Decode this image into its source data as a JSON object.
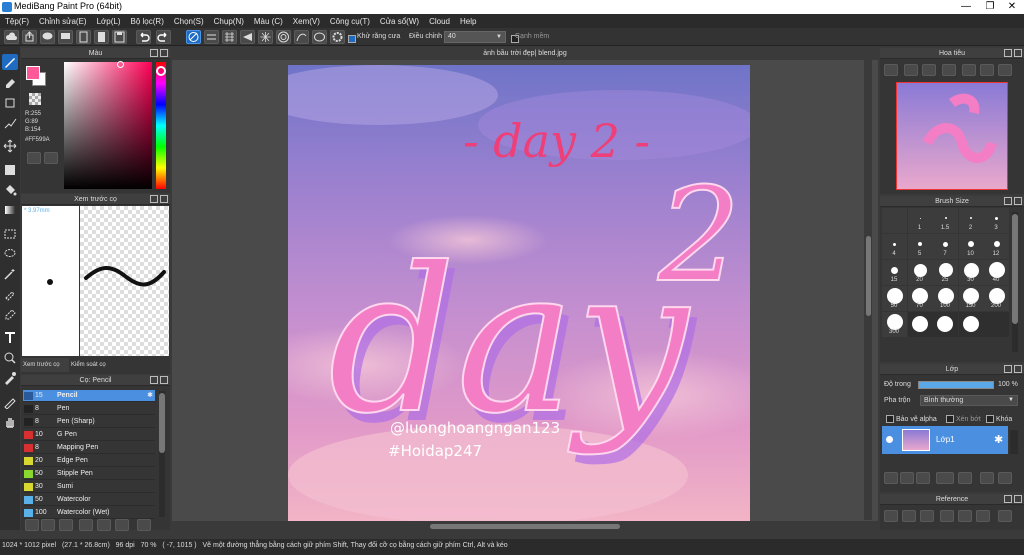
{
  "window": {
    "title": "MediBang Paint Pro (64bit)"
  },
  "menu": [
    "Tệp(F)",
    "Chỉnh sửa(E)",
    "Lớp(L)",
    "Bộ lọc(R)",
    "Chọn(S)",
    "Chụp(N)",
    "Màu (C)",
    "Xem(V)",
    "Công cụ(T)",
    "Cửa sổ(W)",
    "Cloud",
    "Help"
  ],
  "toolbar": {
    "antialias_label": "Khử răng cưa",
    "correction_label": "Điều chỉnh",
    "correction_value": "40",
    "smooth_label": "Cạnh mềm"
  },
  "color_panel": {
    "title": "Màu",
    "r": "R:255",
    "g": "G:89",
    "b": "B:154",
    "hex": "#FF599A",
    "fg_color": "#ff599a",
    "bg_color": "#ffffff"
  },
  "brush_preview": {
    "title": "Xem trước cọ",
    "size_label": "* 3.97mm",
    "tab1": "Xem trước cọ",
    "tab2": "Kiểm soát cọ"
  },
  "brush_list": {
    "title": "Cọ: Pencil",
    "items": [
      {
        "size": "15",
        "name": "Pencil",
        "color": "#2b5a9a",
        "selected": true
      },
      {
        "size": "8",
        "name": "Pen",
        "color": "#222222"
      },
      {
        "size": "8",
        "name": "Pen (Sharp)",
        "color": "#222222"
      },
      {
        "size": "10",
        "name": "G Pen",
        "color": "#d83030"
      },
      {
        "size": "8",
        "name": "Mapping Pen",
        "color": "#d83030"
      },
      {
        "size": "20",
        "name": "Edge Pen",
        "color": "#d8d830"
      },
      {
        "size": "50",
        "name": "Stipple Pen",
        "color": "#8ad830"
      },
      {
        "size": "30",
        "name": "Sumi",
        "color": "#d8d830"
      },
      {
        "size": "50",
        "name": "Watercolor",
        "color": "#5ab0e8"
      },
      {
        "size": "100",
        "name": "Watercolor (Wet)",
        "color": "#5ab0e8"
      }
    ]
  },
  "canvas": {
    "doc_title": "ảnh bầu trời đẹp| blend.jpg",
    "headline": "- day 2 -",
    "big_word": "day",
    "superscript": "2",
    "credit1": "@luonghoangngan123",
    "credit2": "#Hoidap247"
  },
  "navigator": {
    "title": "Hoa tiêu"
  },
  "brush_size": {
    "title": "Brush Size",
    "sizes": [
      "",
      "1",
      "1.5",
      "2",
      "3",
      "4",
      "5",
      "7",
      "10",
      "12",
      "15",
      "20",
      "25",
      "30",
      "40",
      "50",
      "70",
      "100",
      "150",
      "200",
      "300",
      "",
      "",
      "",
      ""
    ]
  },
  "layers": {
    "title": "Lớp",
    "opacity_label": "Độ trong",
    "opacity_value": "100 %",
    "blend_label": "Pha trộn",
    "blend_value": "Bình thường",
    "protect_alpha": "Bảo vệ alpha",
    "clipping": "Xén bớt",
    "lock": "Khóa",
    "layer_name": "Lớp1"
  },
  "reference": {
    "title": "Reference"
  },
  "status": {
    "dims": "1024 * 1012 pixel",
    "size_cm": "(27.1 * 26.8cm)",
    "dpi": "96 dpi",
    "zoom": "70 %",
    "coords": "( -7, 1015 )",
    "hint": "Vẽ một đường thẳng bằng cách giữ phím Shift, Thay đổi cỡ cọ bằng cách giữ phím Ctrl, Alt và kéo"
  }
}
